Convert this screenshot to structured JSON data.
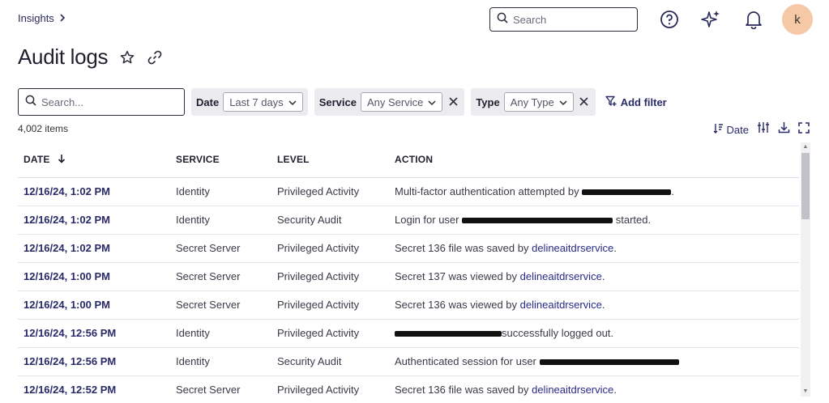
{
  "breadcrumb": {
    "parent": "Insights"
  },
  "topbar": {
    "search_placeholder": "Search",
    "icons": [
      "help-icon",
      "sparkle-icon",
      "bell-icon"
    ],
    "avatar_initial": "k",
    "avatar_color": "#f6c8a6"
  },
  "page": {
    "title": "Audit logs"
  },
  "filters": {
    "search_placeholder": "Search...",
    "date": {
      "label": "Date",
      "value": "Last 7 days"
    },
    "service": {
      "label": "Service",
      "value": "Any Service"
    },
    "type": {
      "label": "Type",
      "value": "Any Type"
    },
    "add_filter_label": "Add filter"
  },
  "results": {
    "count_text": "4,002 items",
    "sort_label": "Date"
  },
  "table": {
    "headers": {
      "date": "DATE",
      "service": "SERVICE",
      "level": "LEVEL",
      "action": "ACTION"
    },
    "rows": [
      {
        "date": "12/16/24, 1:02 PM",
        "service": "Identity",
        "level": "Privileged Activity",
        "action_pre": "Multi-factor authentication attempted by ",
        "action_link": "",
        "action_post": "."
      },
      {
        "date": "12/16/24, 1:02 PM",
        "service": "Identity",
        "level": "Security Audit",
        "action_pre": "Login for user ",
        "action_link": "",
        "action_post": " started."
      },
      {
        "date": "12/16/24, 1:02 PM",
        "service": "Secret Server",
        "level": "Privileged Activity",
        "action_pre": "Secret 136 file was saved by ",
        "action_link": "delineaitdrservice",
        "action_post": "."
      },
      {
        "date": "12/16/24, 1:00 PM",
        "service": "Secret Server",
        "level": "Privileged Activity",
        "action_pre": "Secret 137 was viewed by ",
        "action_link": "delineaitdrservice",
        "action_post": "."
      },
      {
        "date": "12/16/24, 1:00 PM",
        "service": "Secret Server",
        "level": "Privileged Activity",
        "action_pre": "Secret 136 was viewed by ",
        "action_link": "delineaitdrservice",
        "action_post": "."
      },
      {
        "date": "12/16/24, 12:56 PM",
        "service": "Identity",
        "level": "Privileged Activity",
        "action_pre": "",
        "action_link": "",
        "action_post": "successfully logged out."
      },
      {
        "date": "12/16/24, 12:56 PM",
        "service": "Identity",
        "level": "Security Audit",
        "action_pre": "Authenticated session for user ",
        "action_link": "",
        "action_post": ""
      },
      {
        "date": "12/16/24, 12:52 PM",
        "service": "Secret Server",
        "level": "Privileged Activity",
        "action_pre": "Secret 136 file was saved by ",
        "action_link": "delineaitdrservice",
        "action_post": "."
      }
    ]
  }
}
